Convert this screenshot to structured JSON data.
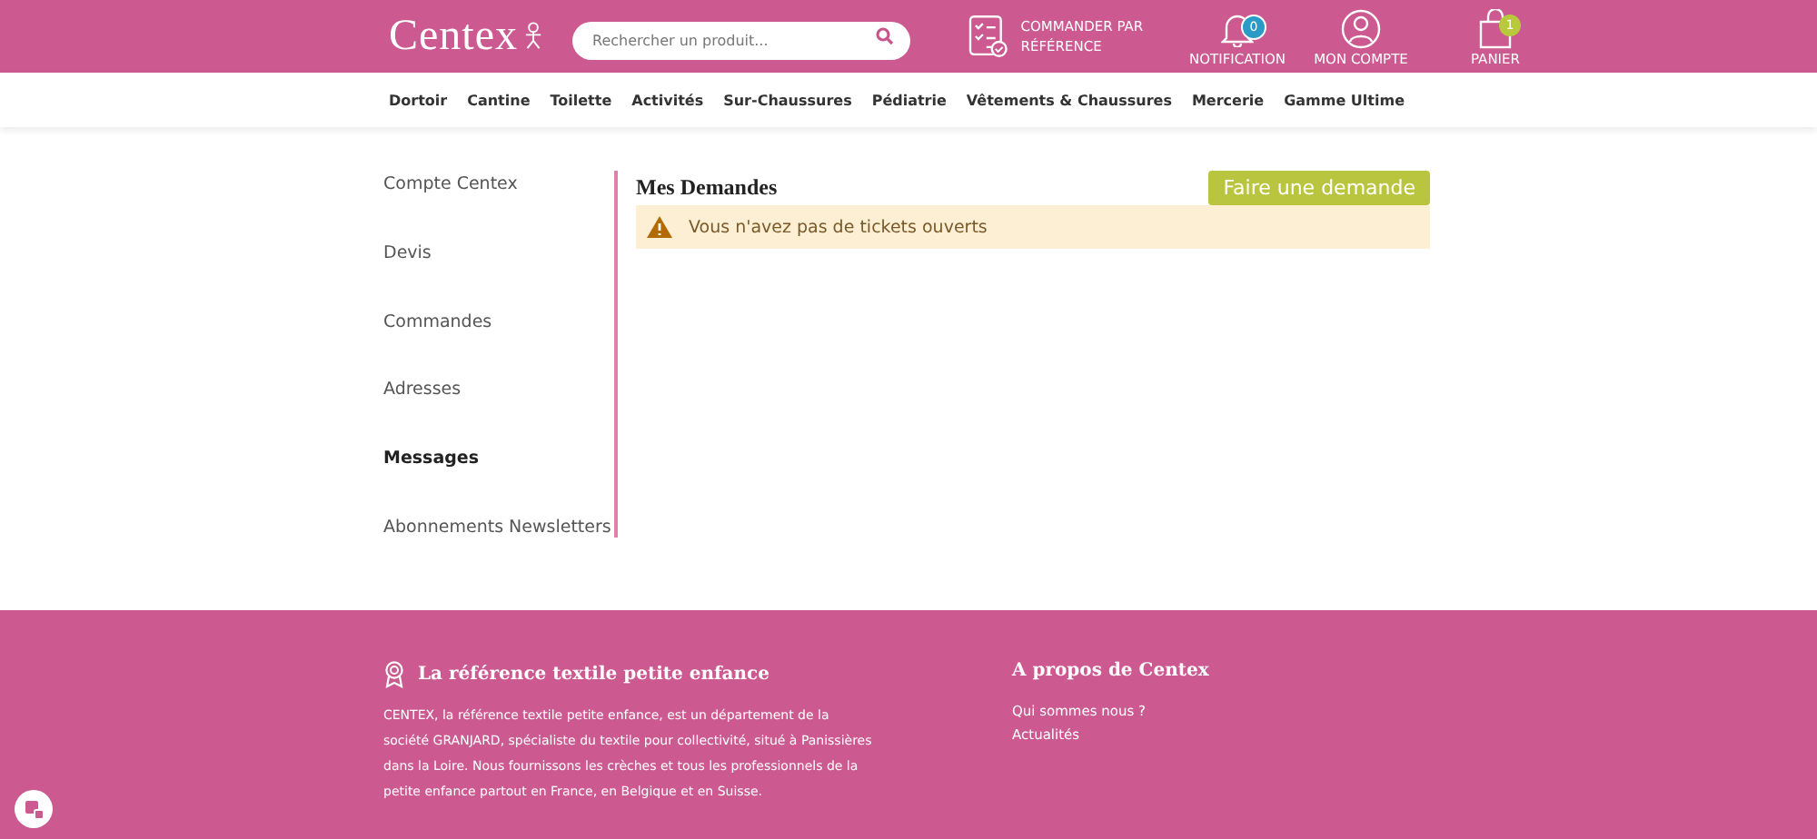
{
  "header": {
    "logo": "Centex",
    "search": {
      "placeholder": "Rechercher un produit..."
    },
    "order_by_reference": "COMMANDER PAR RÉFÉRENCE",
    "notification": {
      "label": "NOTIFICATION",
      "count": "0"
    },
    "account": {
      "label": "MON COMPTE"
    },
    "cart": {
      "label": "PANIER",
      "count": "1"
    }
  },
  "nav": [
    "Dortoir",
    "Cantine",
    "Toilette",
    "Activités",
    "Sur-Chaussures",
    "Pédiatrie",
    "Vêtements & Chaussures",
    "Mercerie",
    "Gamme Ultime"
  ],
  "sidebar": {
    "items": [
      {
        "label": "Compte Centex",
        "selected": false
      },
      {
        "label": "Devis",
        "selected": false
      },
      {
        "label": "Commandes",
        "selected": false
      },
      {
        "label": "Adresses",
        "selected": false
      },
      {
        "label": "Messages",
        "selected": true
      },
      {
        "label": "Abonnements Newsletters",
        "selected": false
      }
    ]
  },
  "main": {
    "title": "Mes Demandes",
    "button": "Faire une demande",
    "alert": "Vous n'avez pas de tickets ouverts"
  },
  "footer": {
    "about_title": "La référence textile petite enfance",
    "about_text": "CENTEX, la référence textile petite enfance, est un département de la société GRANJARD, spécialiste du textile pour collectivité, situé à Panissières dans la Loire. Nous fournissons les crèches et tous les professionnels de la petite enfance partout en France, en Belgique et en",
    "about_link": "Suisse.",
    "links_title": "A propos de Centex",
    "links": [
      "Qui sommes nous ?",
      "Actualités"
    ]
  }
}
